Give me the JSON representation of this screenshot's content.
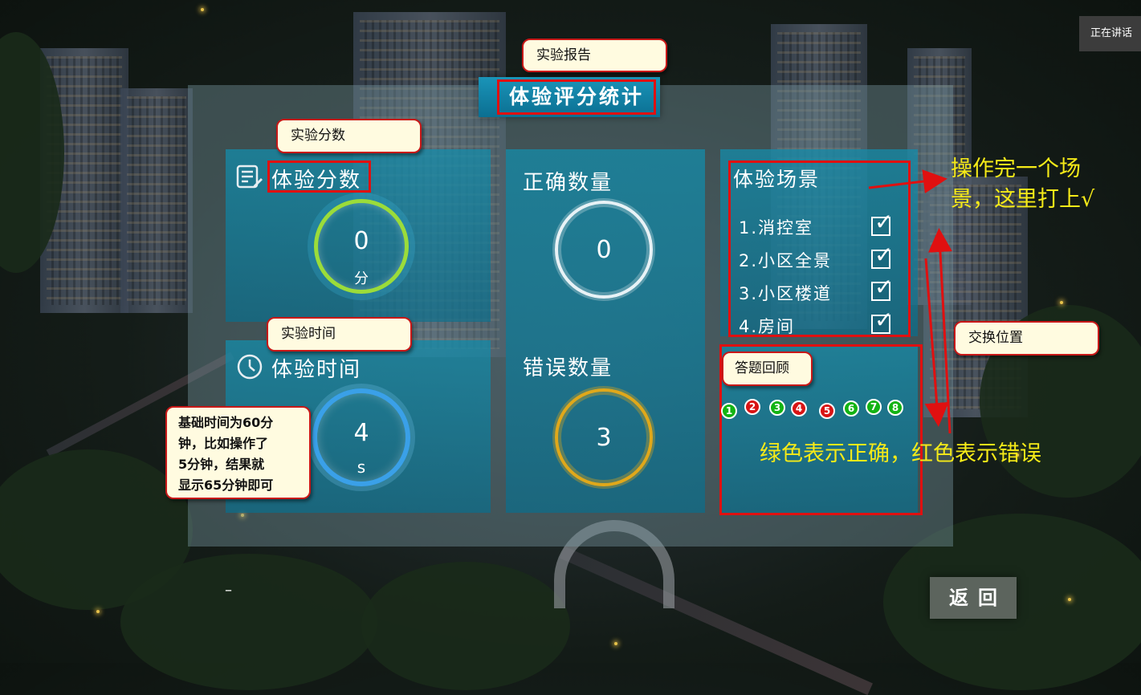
{
  "header": {
    "speaking_status": "正在讲话",
    "title": "体验评分统计"
  },
  "score_card": {
    "label": "体验分数",
    "value": "0",
    "unit": "分"
  },
  "time_card": {
    "label": "体验时间",
    "value": "4",
    "unit": "s"
  },
  "correct_card": {
    "label": "正确数量",
    "value": "0"
  },
  "wrong_card": {
    "label": "错误数量",
    "value": "3"
  },
  "scene_card": {
    "label": "体验场景",
    "items": [
      {
        "label": "1.消控室",
        "checked": true
      },
      {
        "label": "2.小区全景",
        "checked": true
      },
      {
        "label": "3.小区楼道",
        "checked": true
      },
      {
        "label": "4.房间",
        "checked": true
      }
    ],
    "check_glyph": "✓"
  },
  "review_card": {
    "answers": [
      {
        "num": "1",
        "status": "correct"
      },
      {
        "num": "2",
        "status": "wrong"
      },
      {
        "num": "3",
        "status": "correct"
      },
      {
        "num": "4",
        "status": "wrong"
      },
      {
        "num": "5",
        "status": "wrong"
      },
      {
        "num": "6",
        "status": "correct"
      },
      {
        "num": "7",
        "status": "correct"
      },
      {
        "num": "8",
        "status": "correct"
      }
    ]
  },
  "annotations": {
    "report": "实验报告",
    "score": "实验分数",
    "time": "实验时间",
    "time_note_lines": [
      "基础时间为60分",
      "钟，比如操作了",
      "5分钟，结果就",
      "显示65分钟即可"
    ],
    "swap": "交换位置",
    "review": "答题回顾",
    "scene_note_lines": [
      "操作完一个场",
      "景，这里打上√"
    ],
    "color_note": "绿色表示正确，红色表示错误"
  },
  "footer": {
    "back_label": "返回",
    "cursor_mark": "–"
  },
  "colors": {
    "correct": "#13b313",
    "wrong": "#d81414",
    "annotation_red": "#e01010",
    "note_yellow": "#f5ea18",
    "score_ring": "#9bdc3a",
    "time_ring": "#3aa0e8",
    "wrong_ring": "#e0a81a"
  }
}
